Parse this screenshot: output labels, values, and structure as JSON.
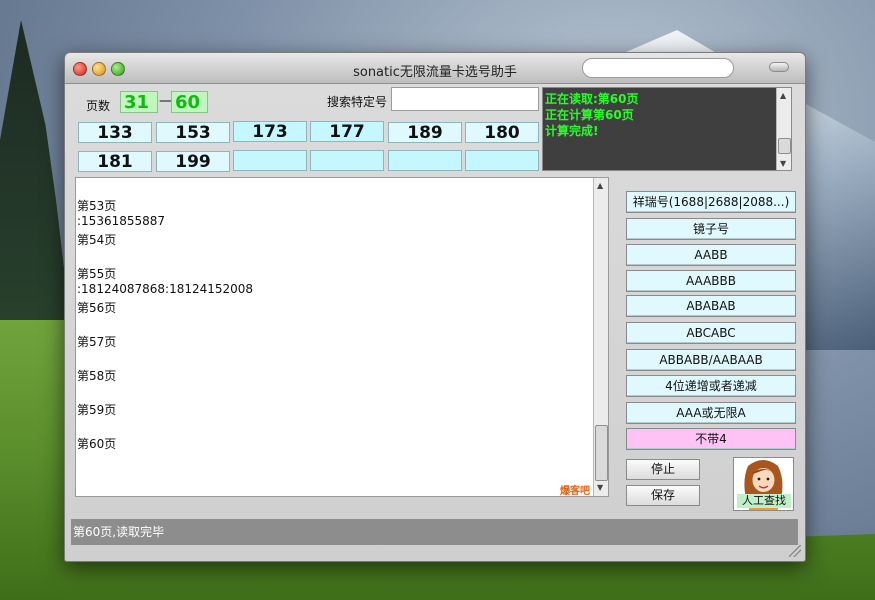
{
  "window": {
    "title": "sonatic无限流量卡选号助手"
  },
  "pages": {
    "label": "页数",
    "from": "31",
    "separator": "—",
    "to": "60"
  },
  "search": {
    "label": "搜索特定号",
    "value": ""
  },
  "numbers": [
    "133",
    "153",
    "173",
    "177",
    "189",
    "180",
    "181",
    "199",
    "",
    "",
    "",
    ""
  ],
  "log": [
    "正在读取:第60页",
    "正在计算第60页",
    "计算完成!"
  ],
  "results": [
    "第53页",
    ":15361855887",
    "第54页",
    "",
    "第55页",
    ":18124087868:18124152008",
    "第56页",
    "",
    "第57页",
    "",
    "第58页",
    "",
    "第59页",
    "",
    "第60页"
  ],
  "brand_mark": "爆客吧",
  "patterns": [
    "祥瑞号(1688|2688|2088...)",
    "镜子号",
    "AABB",
    "AAABBB",
    "ABABAB",
    "ABCABC",
    "ABBABB/AABAAB",
    "4位递增或者递减",
    "AAA或无限A",
    "不带4"
  ],
  "actions": {
    "stop": "停止",
    "save": "保存",
    "manual": "人工查找"
  },
  "status": {
    "text": "第60页,读取完毕"
  },
  "colors": {
    "log_text": "#25ff25",
    "range_text": "#14b814",
    "pattern_bg": "#dff9ff",
    "no4_bg": "#ffc2f5"
  }
}
